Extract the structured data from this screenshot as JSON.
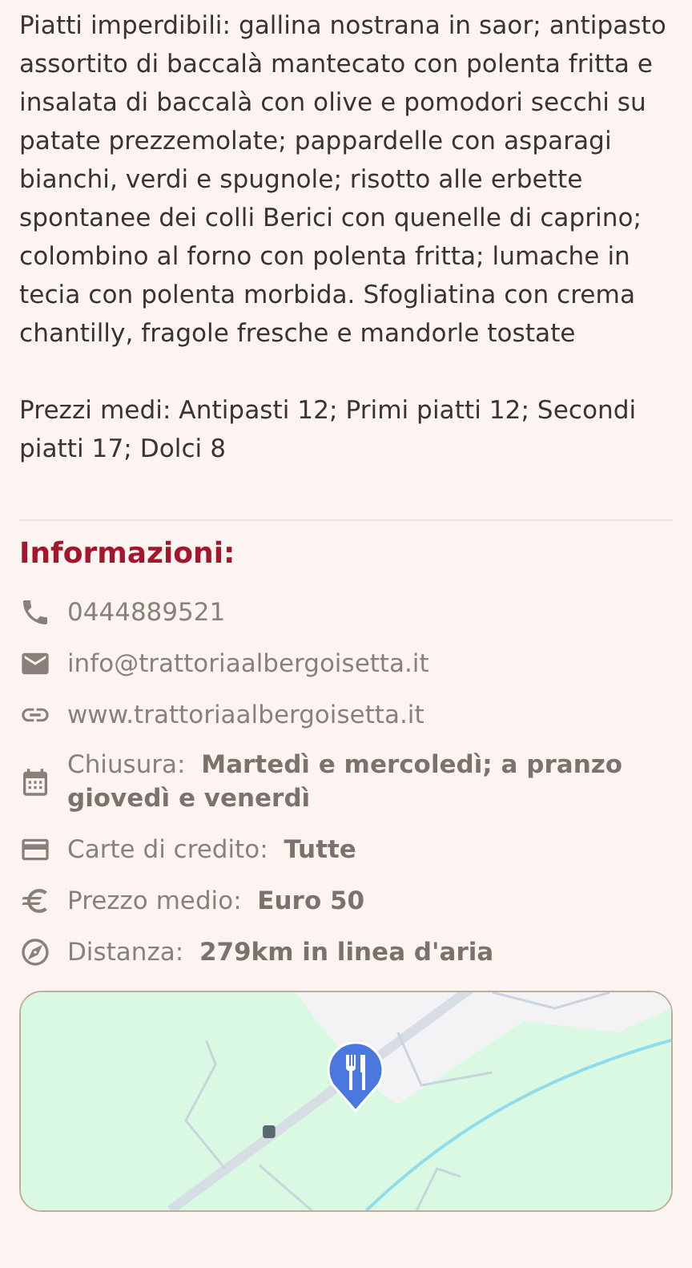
{
  "description": [
    "Piatti imperdibili: gallina nostrana in saor; antipasto assortito di baccalà mantecato con polenta fritta e insalata di baccalà con olive e pomodori secchi su patate prezzemolate; pappardelle con asparagi bianchi, verdi e spugnole; risotto alle erbette spontanee dei colli Berici con quenelle di caprino; colombino al forno con polenta fritta; lumache in tecia con polenta morbida. Sfogliatina con crema chantilly, fragole fresche e mandorle tostate",
    "Prezzi medi: Antipasti 12; Primi piatti 12; Secondi piatti 17; Dolci 8"
  ],
  "info": {
    "title": "Informazioni:",
    "items": [
      {
        "kind": "phone",
        "value": "0444889521"
      },
      {
        "kind": "email",
        "value": "info@trattoriaalbergoisetta.it"
      },
      {
        "kind": "website",
        "value": "www.trattoriaalbergoisetta.it"
      },
      {
        "kind": "closing",
        "label": "Chiusura:",
        "value": "Martedì e mercoledì; a pranzo giovedì e venerdì"
      },
      {
        "kind": "cards",
        "label": "Carte di credito:",
        "value": "Tutte"
      },
      {
        "kind": "price",
        "label": "Prezzo medio:",
        "value": "Euro 50"
      },
      {
        "kind": "distance",
        "label": "Distanza:",
        "value": "279km in linea d'aria"
      }
    ]
  }
}
